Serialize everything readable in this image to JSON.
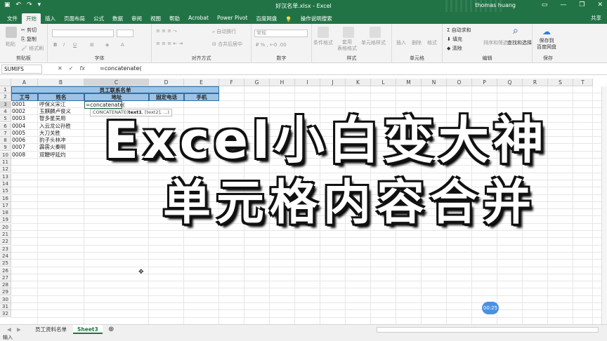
{
  "titlebar": {
    "title": "好汉名单.xlsx  -  Excel",
    "user": "thomas huang",
    "save_icon": "save-icon",
    "undo_icon": "undo-icon",
    "redo_icon": "redo-icon",
    "min_icon": "minimize-icon",
    "restore_icon": "restore-icon",
    "close_icon": "close-icon",
    "accent": "#217346"
  },
  "tabs": [
    "文件",
    "开始",
    "插入",
    "页面布局",
    "公式",
    "数据",
    "审阅",
    "视图",
    "帮助",
    "Acrobat",
    "Power Pivot",
    "百度网盘"
  ],
  "tell_me": "操作说明搜索",
  "share": "共享",
  "ribbon": {
    "clipboard": {
      "label": "剪贴板",
      "paste": "粘贴",
      "cut": "剪切",
      "copy": "复制",
      "format_painter": "格式刷"
    },
    "font": {
      "label": "字体"
    },
    "alignment": {
      "label": "对齐方式",
      "wrap": "自动换行",
      "merge": "合并后居中"
    },
    "number": {
      "label": "数字",
      "format": "常规"
    },
    "styles": {
      "label": "样式",
      "conditional": "条件格式",
      "table": "套用\n表格格式",
      "cell_styles": "单元格样式"
    },
    "cells": {
      "label": "单元格",
      "insert": "插入",
      "delete": "删除",
      "format": "格式"
    },
    "editing": {
      "label": "编辑",
      "autosum": "自动求和",
      "fill": "填充",
      "clear": "清除",
      "sort": "排序和筛选",
      "find": "查找和选择"
    },
    "save": {
      "label": "保存",
      "button": "保存到\n百度网盘"
    }
  },
  "formula_bar": {
    "name_box": "SUMIFS",
    "cancel": "✕",
    "enter": "✓",
    "fx": "fx",
    "content": "=concatenate("
  },
  "columns": [
    "A",
    "B",
    "C",
    "D",
    "E",
    "F",
    "G",
    "H",
    "I",
    "J",
    "K",
    "L",
    "M",
    "N",
    "O",
    "P",
    "Q",
    "R",
    "S",
    "T"
  ],
  "rows": [
    "1",
    "2",
    "3",
    "4",
    "5",
    "6",
    "7",
    "8",
    "9",
    "10",
    "11",
    "12",
    "13",
    "14",
    "15",
    "16",
    "17",
    "18",
    "19",
    "20",
    "21",
    "22",
    "23",
    "24",
    "25",
    "26",
    "27",
    "28",
    "29",
    "30",
    "31",
    "32"
  ],
  "sheet": {
    "title": "员工联系名单",
    "headers": [
      "工号",
      "姓名",
      "地址",
      "固定电话",
      "手机"
    ],
    "ids": [
      "0001",
      "0002",
      "0003",
      "0004",
      "0005",
      "0006",
      "0007",
      "0008"
    ],
    "names": [
      "呼保义宋江",
      "玉麒麟卢俊义",
      "智多星吴用",
      "入云龙公孙胜",
      "大刀关胜",
      "豹子头林冲",
      "霹雳火秦明",
      "双鞭呼延灼"
    ],
    "editing_value": "=concatenate(",
    "tooltip_fn": "CONCATENATE(",
    "tooltip_arg": "text1",
    "tooltip_rest": ", [text2], ...)"
  },
  "overlay": {
    "line1": "Excel小白变大神",
    "line2": "单元格内容合并"
  },
  "timer": "00:25",
  "sheet_tabs": [
    "员工资料名单",
    "Sheet3"
  ],
  "add_sheet": "⊕",
  "status": "输入"
}
